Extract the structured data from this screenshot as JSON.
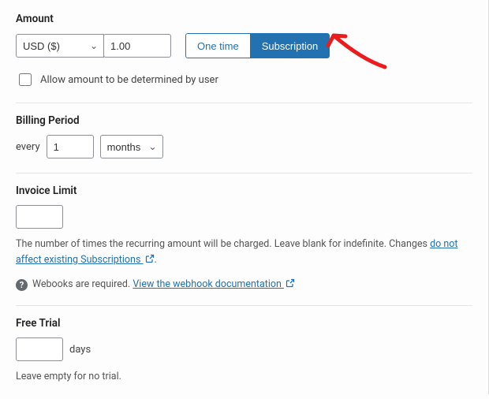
{
  "amount": {
    "label": "Amount",
    "currency_options": [
      "USD ($)"
    ],
    "currency_selected": "USD ($)",
    "value": "1.00",
    "toggle": {
      "one_time": "One time",
      "subscription": "Subscription",
      "active": "subscription"
    },
    "allow_user_amount_label": "Allow amount to be determined by user"
  },
  "billing_period": {
    "label": "Billing Period",
    "prefix": "every",
    "interval_value": "1",
    "unit_options": [
      "months"
    ],
    "unit_selected": "months"
  },
  "invoice_limit": {
    "label": "Invoice Limit",
    "value": "",
    "help_prefix": "The number of times the recurring amount will be charged. Leave blank for indefinite. Changes ",
    "help_link": "do not affect existing Subscriptions",
    "help_suffix": ".",
    "webhook_prefix": "Webooks are required. ",
    "webhook_link": "View the webhook documentation"
  },
  "free_trial": {
    "label": "Free Trial",
    "value": "",
    "suffix": "days",
    "help": "Leave empty for no trial."
  }
}
